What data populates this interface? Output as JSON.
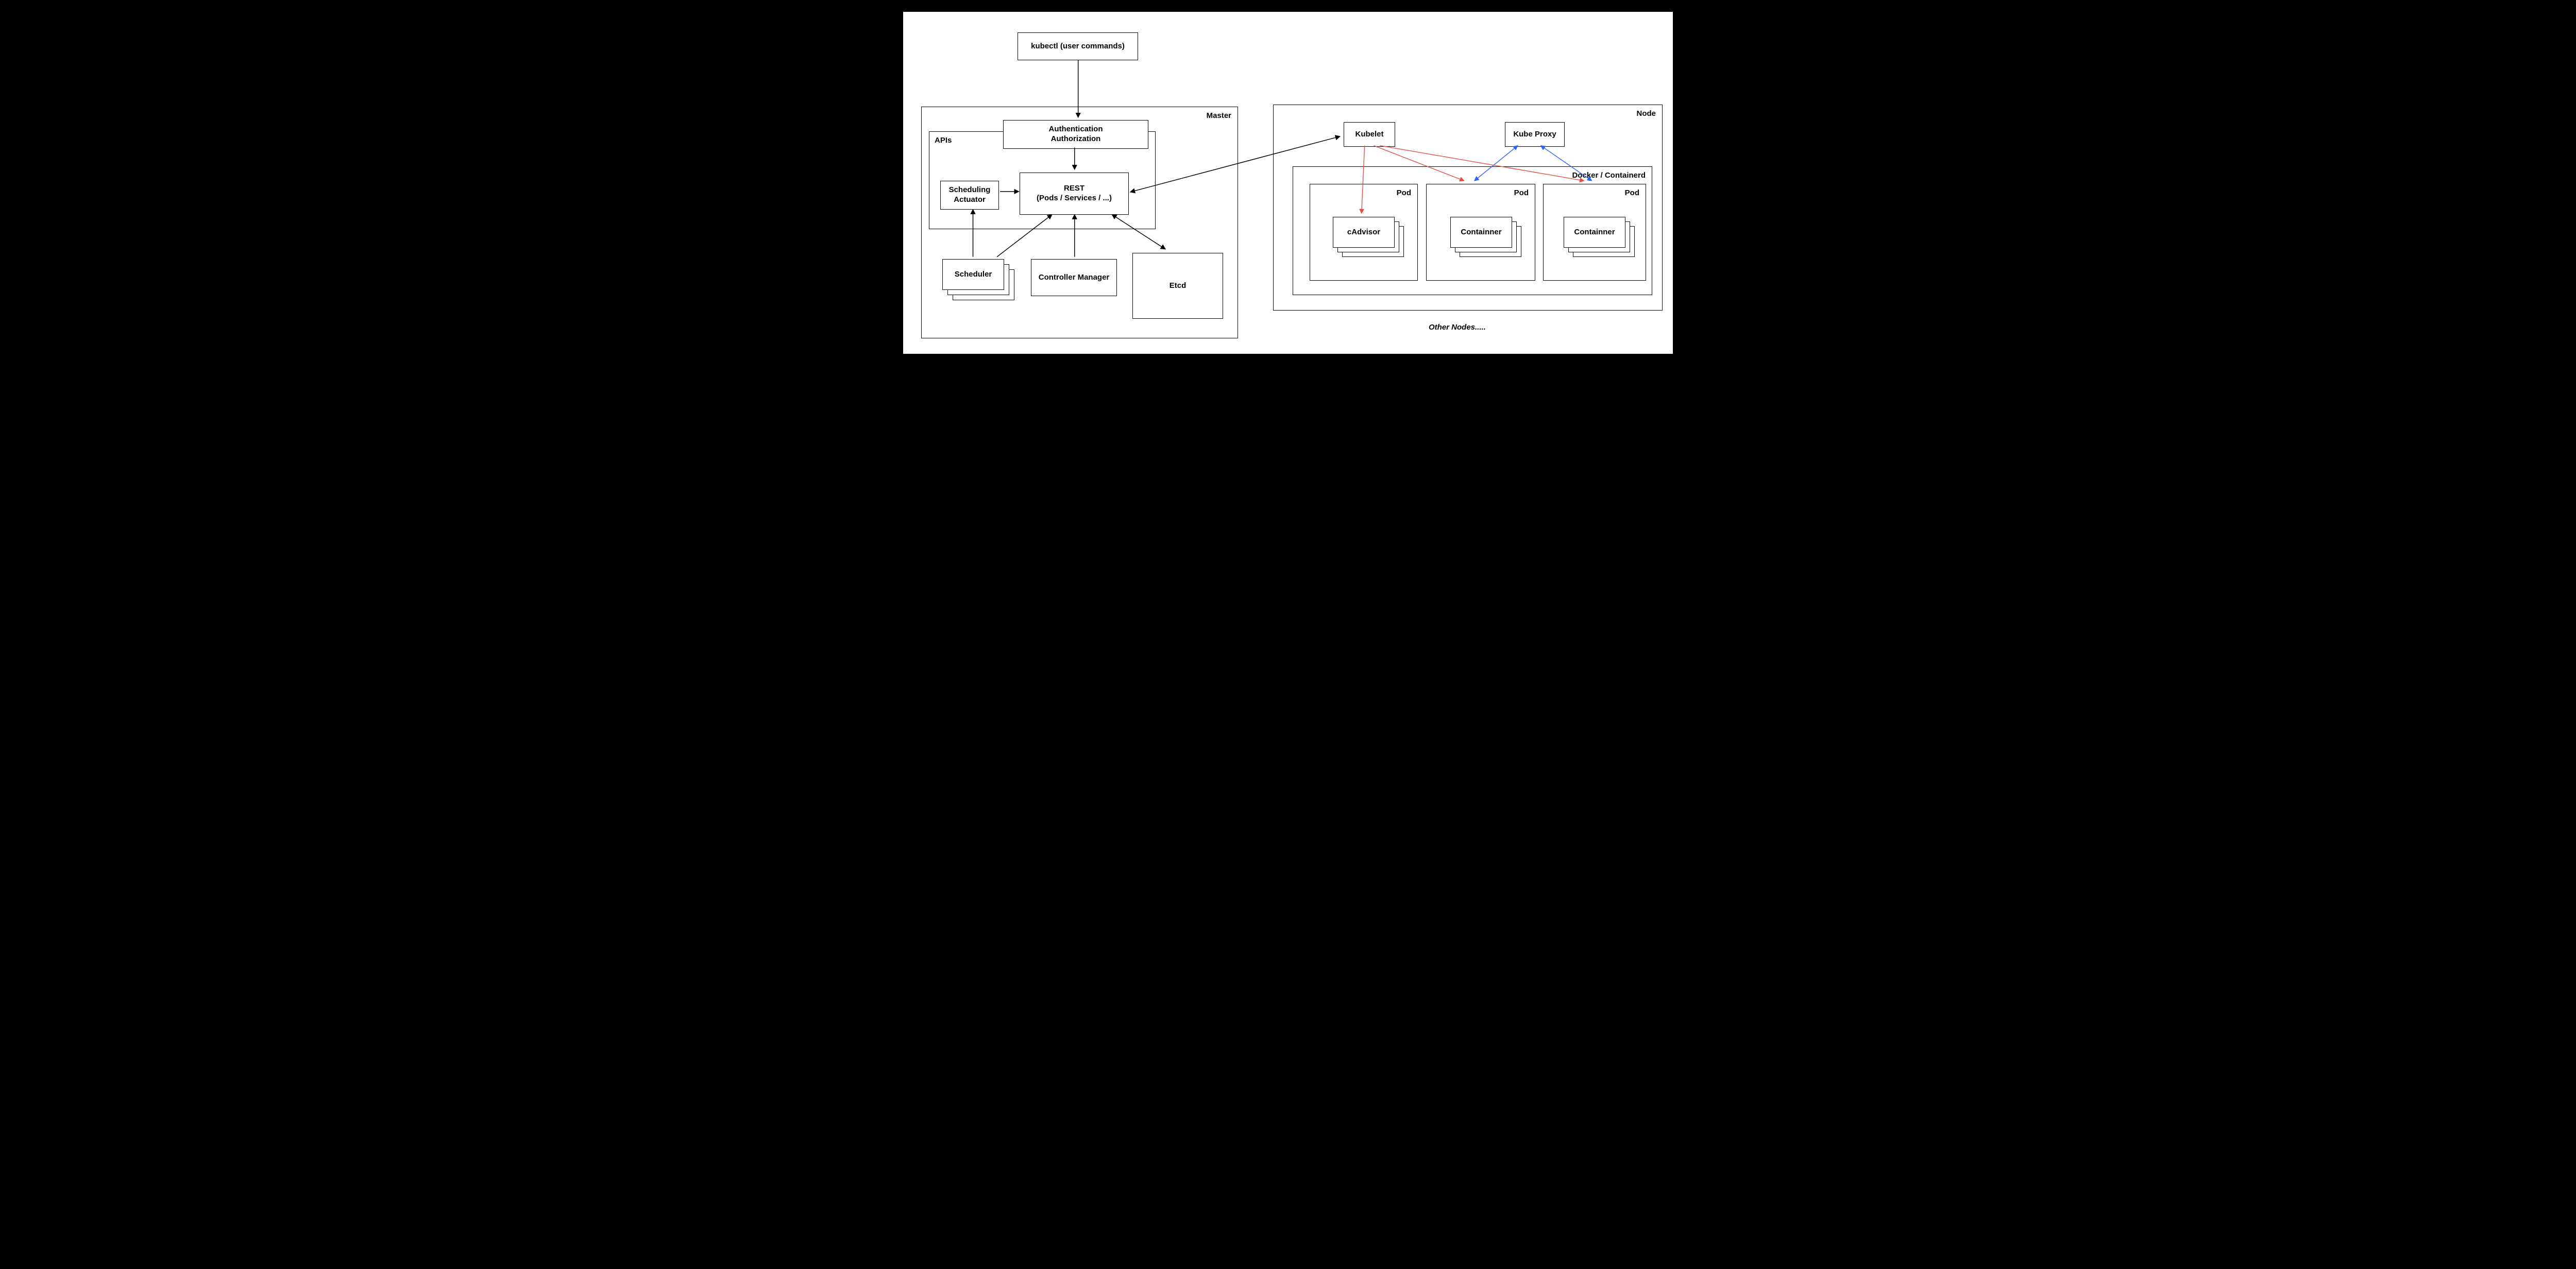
{
  "diagram": {
    "kubectl": "kubectl (user commands)",
    "master": {
      "title": "Master",
      "apis": "APIs",
      "auth_line1": "Authentication",
      "auth_line2": "Authorization",
      "sched_act_line1": "Scheduling",
      "sched_act_line2": "Actuator",
      "rest_line1": "REST",
      "rest_line2": "(Pods / Services / ...)",
      "scheduler": "Scheduler",
      "controller_manager": "Controller Manager",
      "etcd": "Etcd"
    },
    "node": {
      "title": "Node",
      "kubelet": "Kubelet",
      "kube_proxy": "Kube Proxy",
      "docker": "Docker /  Containerd",
      "pod_label": "Pod",
      "cadvisor": "cAdvisor",
      "container": "Containner"
    },
    "other_nodes": "Other Nodes....."
  }
}
